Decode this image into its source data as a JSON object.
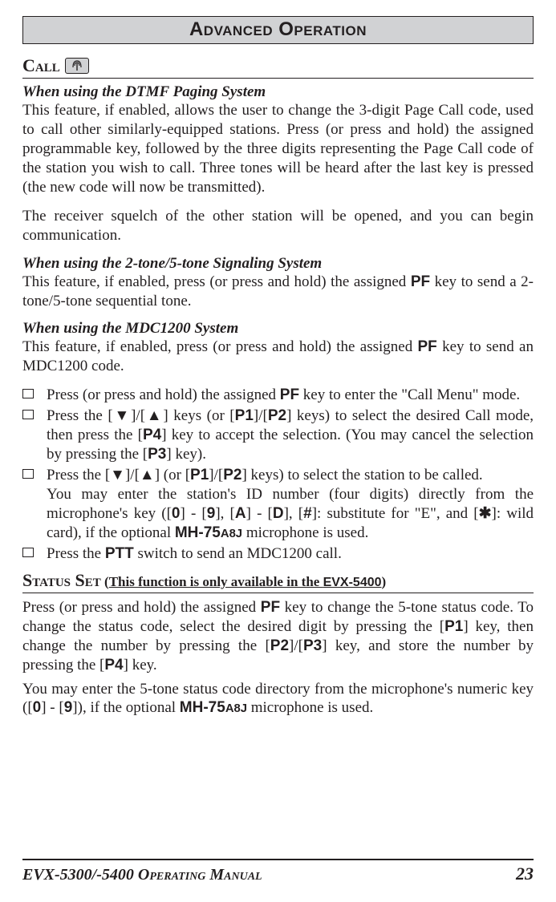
{
  "banner": "Advanced Operation",
  "call_label": "Call",
  "sections": {
    "dtmf_head": "When using the DTMF Paging System",
    "dtmf_p1_a": "This feature, if enabled, allows the user to change the 3-digit Page Call code, used to call other similarly-equipped stations. Press (or press and hold) the assigned programmable key, followed by the three digits representing the Page Call code of the station you wish to call. Three tones will be heard after the last key is pressed (the new code will now be transmitted).",
    "dtmf_p2": "The receiver squelch of the other station will be opened, and you can begin communication.",
    "tone_head": "When using the 2-tone/5-tone Signaling System",
    "tone_p_a": "This feature, if enabled, press (or press and hold) the assigned ",
    "tone_p_b": " key to send a 2-tone/5-tone sequential tone.",
    "mdc_head": "When using the MDC1200 System",
    "mdc_p_a": "This feature, if enabled, press (or press and hold) the assigned ",
    "mdc_p_b": " key to send an MDC1200 code."
  },
  "list": {
    "i1_a": "Press (or press and hold) the assigned ",
    "i1_b": " key to enter the \"Call Menu\" mode.",
    "i2_a": "Press the [",
    "i2_b": "]/[",
    "i2_c": "] keys (or [",
    "i2_d": "]/[",
    "i2_e": "] keys) to select the desired Call mode, then press the [",
    "i2_f": "] key to accept the selection. (You may cancel the selection by pressing the [",
    "i2_g": "] key).",
    "i3_a": "Press the [",
    "i3_b": "]/[",
    "i3_c": "] (or [",
    "i3_d": "]/[",
    "i3_e": "] keys) to select the station to be called.",
    "i3_p2_a": "You may enter the station's ID number (four digits) directly from the microphone's key ([",
    "i3_p2_b": "] - [",
    "i3_p2_c": "], [",
    "i3_p2_d": "] - [",
    "i3_p2_e": "], [",
    "i3_p2_f": "]: substitute for \"E\", and [",
    "i3_p2_g": "]: wild card), if the optional ",
    "i3_p2_h": " microphone is used.",
    "i4_a": "Press the ",
    "i4_b": " switch to send an MDC1200 call."
  },
  "keys": {
    "PF": "PF",
    "P1": "P1",
    "P2": "P2",
    "P3": "P3",
    "P4": "P4",
    "PTT": "PTT",
    "k0": "0",
    "k9": "9",
    "kA": "A",
    "kD": "D",
    "kHash": "#",
    "kStar": "✱",
    "down": "▼",
    "up": "▲"
  },
  "mh": {
    "base": "MH-75",
    "suffix": "A8J"
  },
  "status": {
    "head": "Status Set",
    "paren_a": " (",
    "paren_text": "This function is only available in the ",
    "model": "EVX-5400",
    "paren_b": ")",
    "p1_a": "Press (or press and hold) the assigned ",
    "p1_b": " key to change the 5-tone status code. To change the status code, select the desired digit by pressing the [",
    "p1_c": "] key, then change the number by pressing the [",
    "p1_d": "]/[",
    "p1_e": "] key, and store the number by pressing the [",
    "p1_f": "] key.",
    "p2_a": "You may enter the 5-tone status code directory from the microphone's numeric key ([",
    "p2_b": "] - [",
    "p2_c": "]), if the optional ",
    "p2_d": " microphone is used."
  },
  "footer": {
    "title_a": "EVX-5300/-5400 ",
    "title_b": "Operating Manual",
    "page": "23"
  }
}
